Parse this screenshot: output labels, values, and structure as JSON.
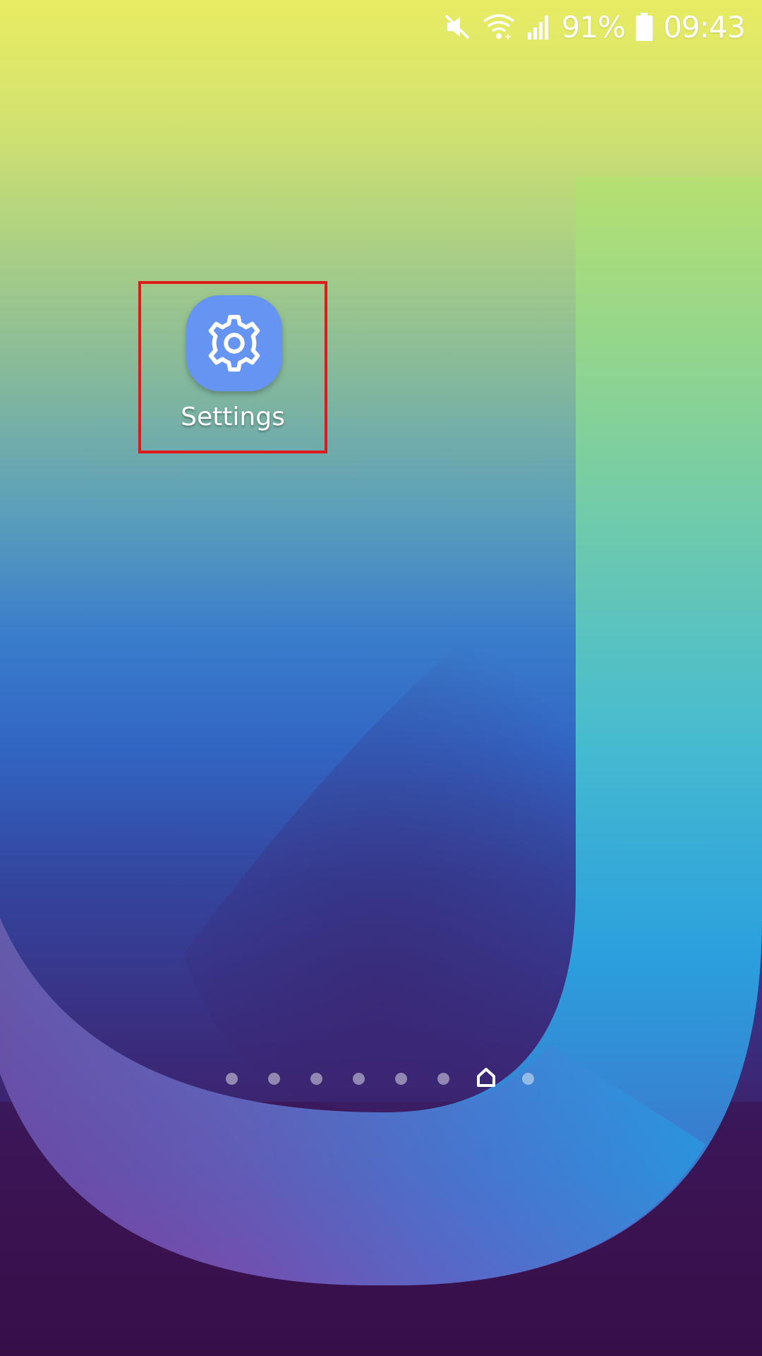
{
  "status_bar": {
    "icons": [
      "mute-icon",
      "wifi-icon",
      "signal-icon",
      "battery-icon"
    ],
    "battery_percent": "91%",
    "time": "09:43"
  },
  "home_screen": {
    "apps": [
      {
        "label": "Settings",
        "icon": "gear-icon",
        "tile_color": "#6694f2"
      }
    ],
    "highlight_color": "#e01a1a",
    "page_indicator": {
      "pages": 8,
      "current_page": 7,
      "current_is_home": true
    }
  }
}
